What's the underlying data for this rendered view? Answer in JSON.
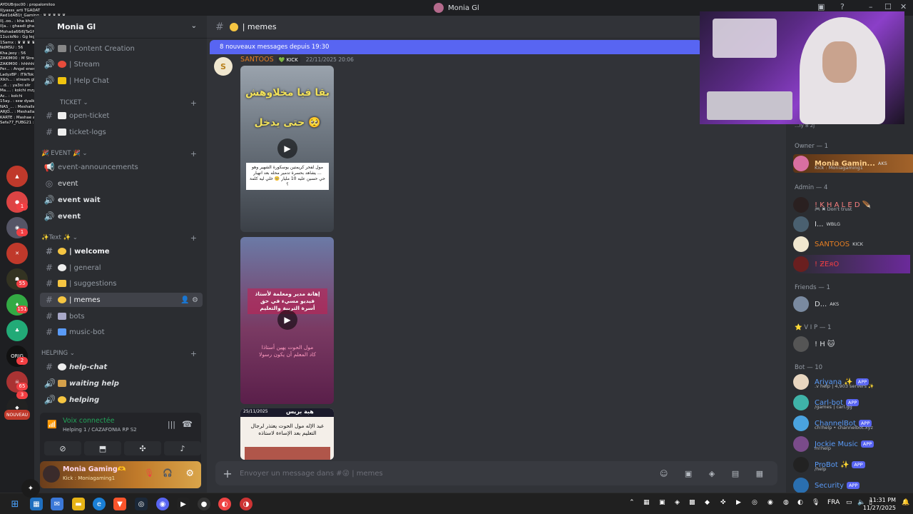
{
  "window": {
    "title": "Monia Gl",
    "min": "–",
    "max": "☐",
    "close": "✕"
  },
  "chat_overlay": [
    "AYOUBrjoc00 : propalomiloo",
    "Il|yasss_arti TGADAT",
    "Red1dAB1t_Gaming : ♛ ♛ ♛ ♛ ♛",
    "ll|..oo.. : kha khala khalaaa",
    "ll|a.. : ghaadi ghaaada",
    "Mohada66i6jTaGHira : Chubba Nozhta",
    "11ucioNo : Gg legend",
    "1Samx : ♛ ♛ ♛ ♛ ♛ ♛ ♛",
    "NdMSU : 56",
    "Kha.jeoy : 56",
    "ZAKIM00 : M Stream Queen",
    "ZAKIM00 : hhhhhhhhhhhhhhhhhhhh",
    "Per... : Angel energy",
    "LadyzBP : ITIkTok",
    "Xikh... : stream ghadi ykon ghzal",
    "...d.. : ya3ni slir",
    "Ma.... : kolchi mzyan",
    "Ac.. : kolchi",
    "15ay.. : ssw dyalk ndwz hiya",
    "NAS_... : Meshallah 39k",
    "ARJO... : Meshallah 39k",
    "KARTE : Mashae allah 39k",
    "Sefa77_FUBG21 : Mashalh 39k"
  ],
  "rail": {
    "badges": [
      "1",
      "1",
      "55",
      "151",
      "2",
      "65",
      "3"
    ],
    "labels": {
      "nouveau": "NOUVEAU",
      "orig": "ORIG"
    }
  },
  "server": {
    "name": "Monia Gl"
  },
  "channels": [
    {
      "type": "text",
      "label": "| Content Creation",
      "icon": "volume-icon"
    },
    {
      "type": "voice",
      "label": "| Stream",
      "icon": "volume-icon"
    },
    {
      "type": "voice",
      "label": "| Help Chat",
      "icon": "volume-icon"
    },
    {
      "type": "category",
      "label": "TICKET ⌄"
    },
    {
      "type": "text",
      "label": "open-ticket",
      "icon": "hash-icon"
    },
    {
      "type": "text",
      "label": "ticket-logs",
      "icon": "hash-icon"
    },
    {
      "type": "category",
      "label": "🎉 EVENT 🎉 ⌄"
    },
    {
      "type": "announce",
      "label": "event-announcements",
      "icon": "megaphone-icon"
    },
    {
      "type": "stage",
      "label": "event",
      "icon": "stage-icon"
    },
    {
      "type": "voice",
      "label": "event wait",
      "icon": "volume-icon"
    },
    {
      "type": "voice",
      "label": "event",
      "icon": "volume-icon"
    },
    {
      "type": "category",
      "label": "✨Text ✨ ⌄"
    },
    {
      "type": "text",
      "label": "| welcome",
      "icon": "hash-icon"
    },
    {
      "type": "text",
      "label": "| general",
      "icon": "hash-icon"
    },
    {
      "type": "text",
      "label": "| suggestions",
      "icon": "hash-icon"
    },
    {
      "type": "text",
      "label": "| memes",
      "icon": "hash-icon"
    },
    {
      "type": "text",
      "label": "bots",
      "icon": "hash-icon"
    },
    {
      "type": "text",
      "label": "music-bot",
      "icon": "hash-icon"
    },
    {
      "type": "category",
      "label": "HELPING ⌄"
    },
    {
      "type": "text",
      "label": "help-chat",
      "icon": "hash-icon"
    },
    {
      "type": "voice",
      "label": "waiting help",
      "icon": "volume-icon"
    },
    {
      "type": "voice",
      "label": "helping",
      "icon": "volume-icon"
    }
  ],
  "voice": {
    "status": "Voix connectée",
    "channel": "Helping 1 / CAZAFONIA RP S2"
  },
  "user": {
    "name": "Monia Gaming🫶",
    "status": "Kick : Moniagaming1"
  },
  "main": {
    "channel": "| memes",
    "new_messages": "8 nouveaux messages depuis 19:30",
    "author": "SANTOOS",
    "author_tag": "KICK",
    "timestamp": "22/11/2025 20:06",
    "avatar_letter": "S",
    "media1": {
      "line1": "بقا فيا مخلاوهش",
      "line2": "حتى يدخل 🥺",
      "caption": "مول لفحر كريمتين يوسكورة الشهير وهو يشاهد بحسرة تدمير محله بعد انهيار ...",
      "sub": "حي حسين عليه 10 مليار 🥺 خلي ليه كلمة ؟"
    },
    "media2": {
      "line1": "إهانة مدير ومعلمة لأستاذ",
      "line2": "فيديو مسيء في حق",
      "line3": "أسرة التربية والتعليم",
      "caption": "مول الحوت يهين أستاذا",
      "sub": "كاد المعلم أن يكون رسولا"
    },
    "media3": {
      "date": "25/11/2025",
      "brand": "هبة بريس",
      "caption": "عبد الإله مول الحوت يعتذر لرجال التعليم بعد الإساءة لاستاذه"
    },
    "composer_placeholder": "Envoyer un message dans #😜 | memes"
  },
  "members": {
    "groups": [
      {
        "title": "Owner — 1",
        "items": [
          {
            "name": "Monia Gamin...",
            "badge": "AKS",
            "sub": "Kick : Moniagaming1",
            "color": "#f0a050"
          }
        ]
      },
      {
        "title": "Admin — 4",
        "items": [
          {
            "name": "! K H A L E D 🪶",
            "sub": "🎮 ✖ Don't trust",
            "color": "#f23f43"
          },
          {
            "name": "I...",
            "badge": "WBLG",
            "color": "#dbdee1"
          },
          {
            "name": "SANTOOS",
            "badge": "KICK",
            "color": "#e67e22"
          },
          {
            "name": "! ƵEᴙO",
            "color": "#f23f43"
          }
        ]
      },
      {
        "title": "Friends — 1",
        "items": [
          {
            "name": "D...",
            "badge": "AKS",
            "color": "#dbdee1"
          }
        ]
      },
      {
        "title": "⭐ V I P — 1",
        "items": [
          {
            "name": "! H 🐱",
            "color": "#dbdee1"
          }
        ]
      },
      {
        "title": "Bot — 10",
        "items": [
          {
            "name": "Ariyana ✨",
            "badge": "APP",
            "sub": ".v help | 4,903 servers ✨",
            "color": "#5a9bf8"
          },
          {
            "name": "Carl-bot",
            "badge": "APP",
            "sub": "/games | carl.gg",
            "color": "#5a9bf8"
          },
          {
            "name": "ChannelBot",
            "badge": "APP",
            "sub": "ch!help • channelbot.xyz",
            "color": "#5a9bf8"
          },
          {
            "name": "Jockie Music",
            "badge": "APP",
            "sub": "m!help",
            "color": "#5a9bf8"
          },
          {
            "name": "ProBot ✨",
            "badge": "APP",
            "sub": "/help",
            "color": "#5a9bf8"
          },
          {
            "name": "Security",
            "badge": "APP",
            "color": "#5a9bf8"
          }
        ]
      }
    ],
    "partial_top": "...ly 8 2j"
  },
  "taskbar": {
    "lang": "FRA",
    "time": "11:31 PM",
    "date": "11/27/2025"
  }
}
